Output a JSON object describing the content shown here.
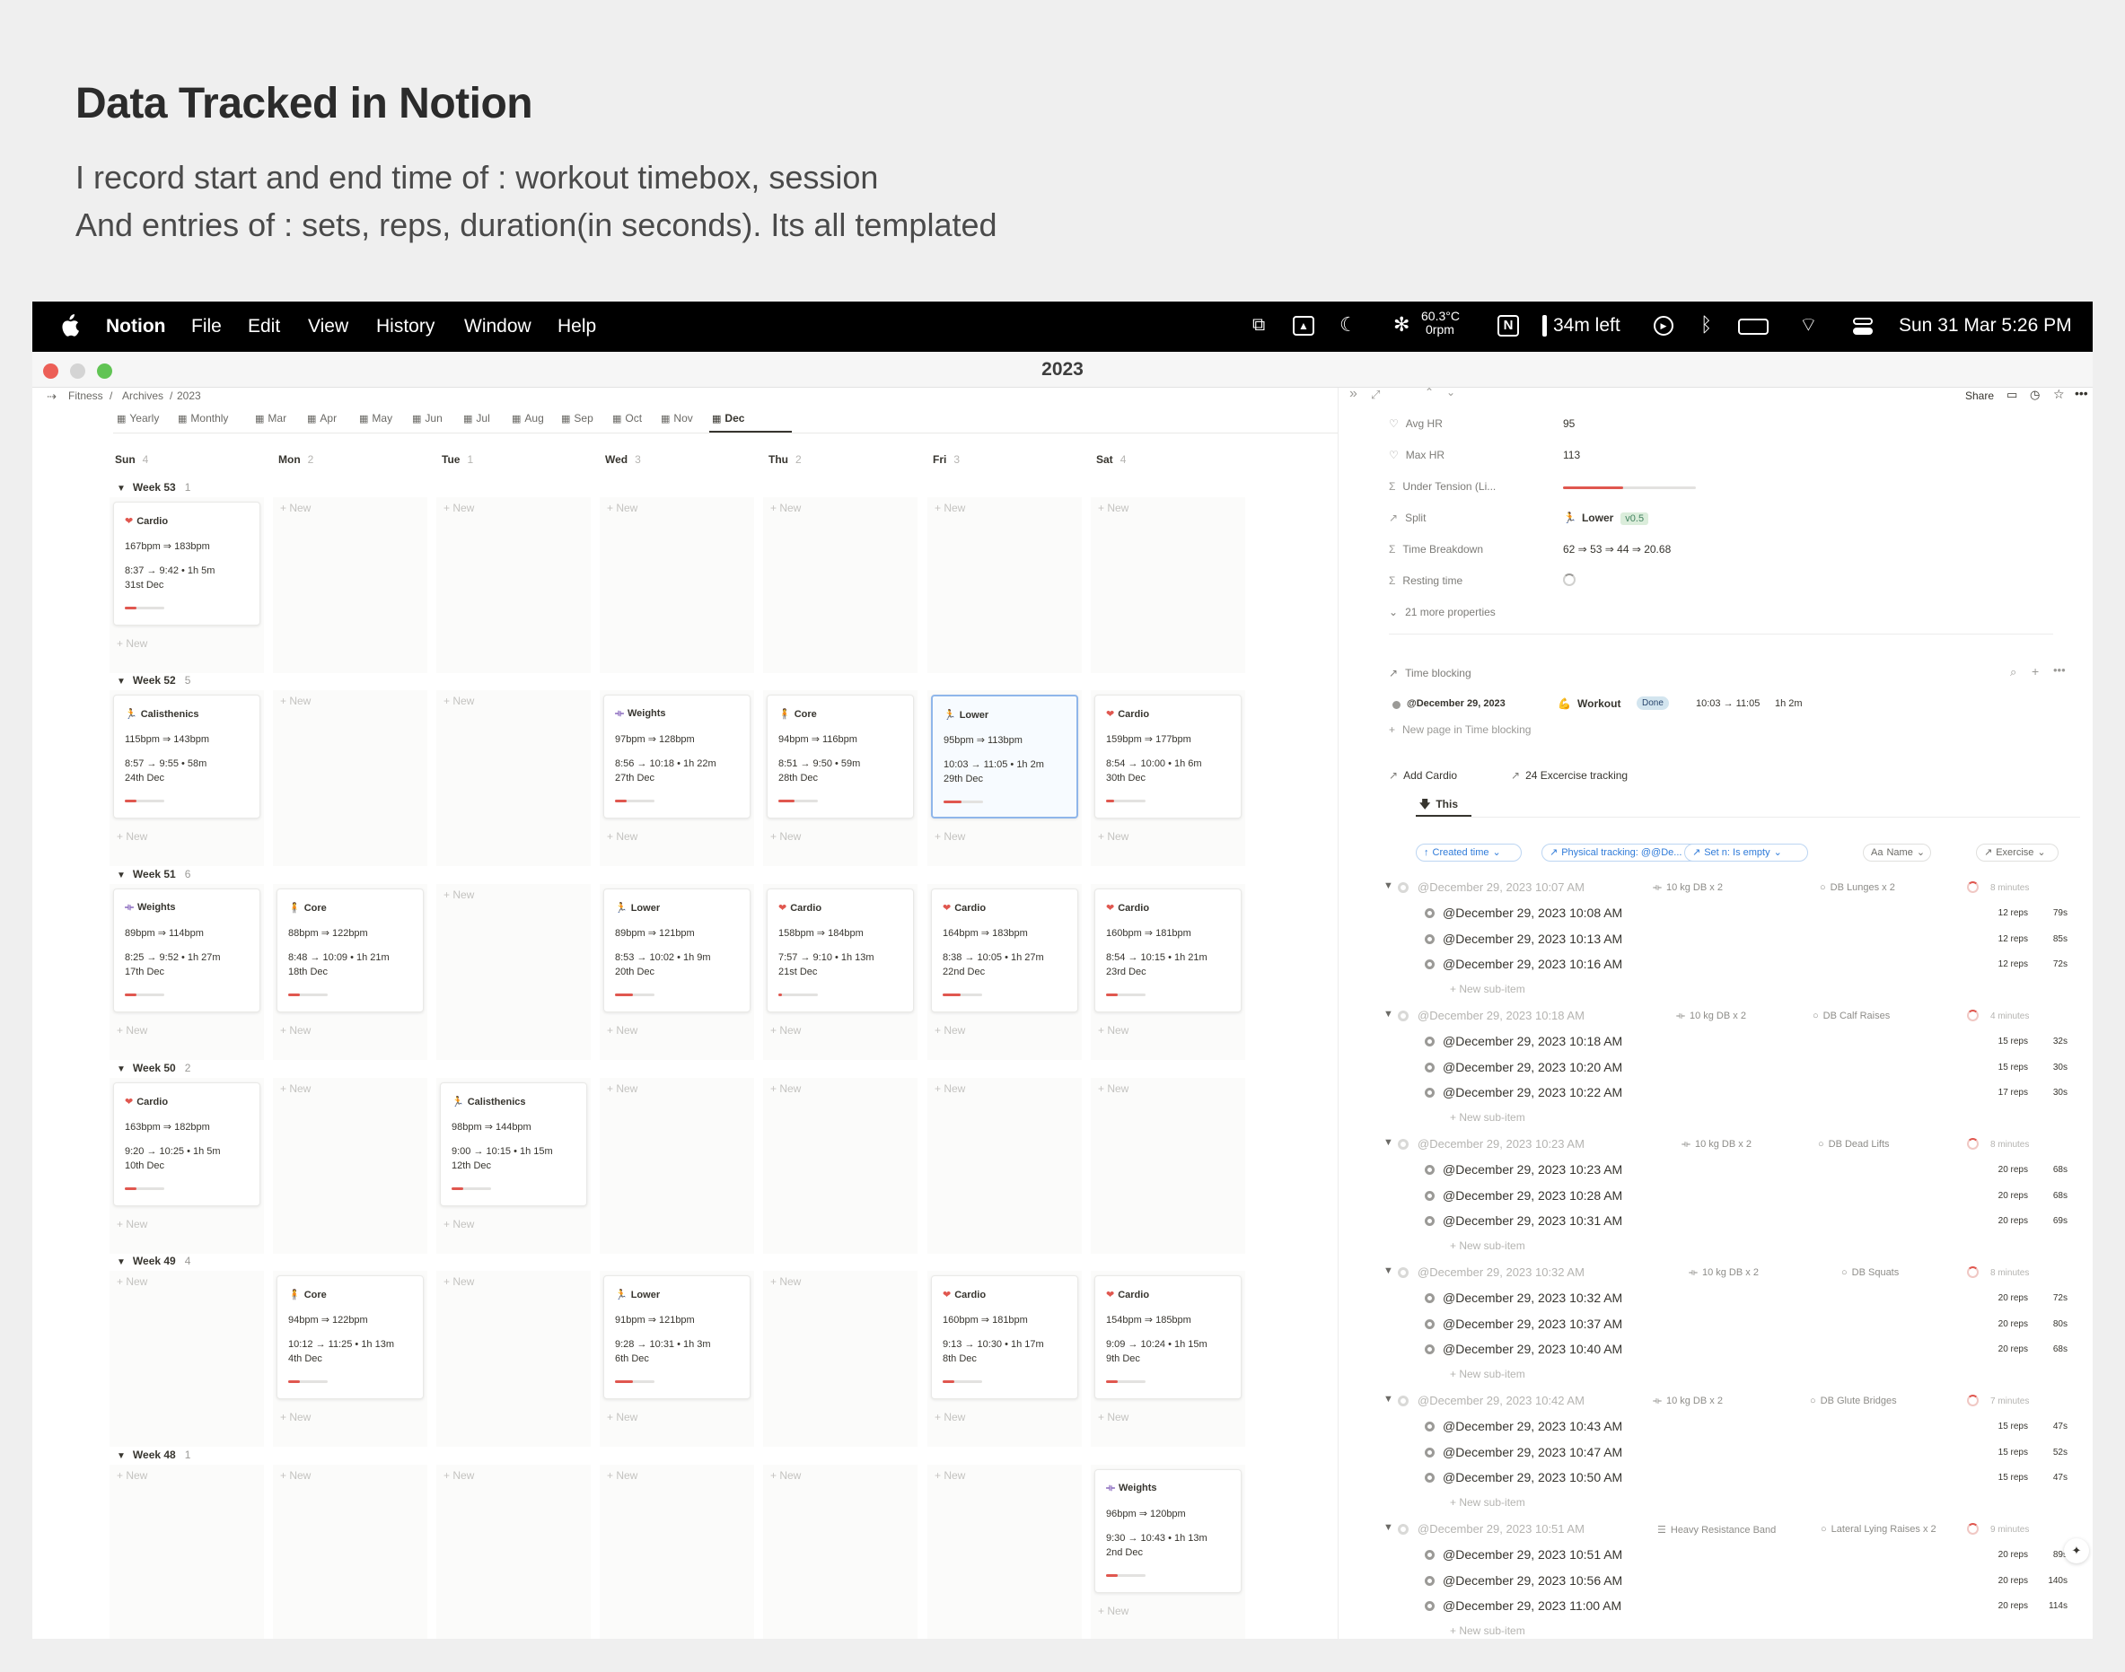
{
  "slide": {
    "title": "Data Tracked in Notion",
    "line1": "I record start and end time of : workout timebox, session",
    "line2": "And entries of : sets, reps, duration(in seconds). Its all templated"
  },
  "menubar": {
    "app": "Notion",
    "menus": [
      "File",
      "Edit",
      "View",
      "History",
      "Window",
      "Help"
    ],
    "temp": "60.3°C",
    "rpm": "0rpm",
    "battery": "34m left",
    "datetime": "Sun 31 Mar  5:26 PM"
  },
  "window": {
    "title": "2023"
  },
  "breadcrumb": [
    "Fitness",
    "Archives",
    "2023"
  ],
  "view_tabs": [
    "Yearly",
    "Monthly",
    "Mar",
    "Apr",
    "May",
    "Jun",
    "Jul",
    "Aug",
    "Sep",
    "Oct",
    "Nov",
    "Dec"
  ],
  "days": [
    {
      "name": "Sun",
      "count": "4"
    },
    {
      "name": "Mon",
      "count": "2"
    },
    {
      "name": "Tue",
      "count": "1"
    },
    {
      "name": "Wed",
      "count": "3"
    },
    {
      "name": "Thu",
      "count": "2"
    },
    {
      "name": "Fri",
      "count": "3"
    },
    {
      "name": "Sat",
      "count": "4"
    }
  ],
  "new_label": "New",
  "weeks": [
    {
      "label": "Week 53",
      "count": "1",
      "cards": [
        {
          "day": 0,
          "icon": "heart-icon",
          "type": "Cardio",
          "bpm": "167bpm ⇒ 183bpm",
          "time": "8:37 → 9:42 • 1h 5m",
          "date": "31st Dec",
          "progress": 0.3
        }
      ]
    },
    {
      "label": "Week 52",
      "count": "5",
      "cards": [
        {
          "day": 0,
          "icon": "calisthenics-icon",
          "type": "Calisthenics",
          "bpm": "115bpm ⇒ 143bpm",
          "time": "8:57 → 9:55 • 58m",
          "date": "24th Dec",
          "progress": 0.3
        },
        {
          "day": 3,
          "icon": "dumbbell-icon",
          "type": "Weights",
          "bpm": "97bpm ⇒ 128bpm",
          "time": "8:56 → 10:18 • 1h 22m",
          "date": "27th Dec",
          "progress": 0.3
        },
        {
          "day": 4,
          "icon": "core-icon",
          "type": "Core",
          "bpm": "94bpm ⇒ 116bpm",
          "time": "8:51 → 9:50 • 59m",
          "date": "28th Dec",
          "progress": 0.4
        },
        {
          "day": 5,
          "icon": "runner-icon",
          "type": "Lower",
          "bpm": "95bpm ⇒ 113bpm",
          "time": "10:03 → 11:05 • 1h 2m",
          "date": "29th Dec",
          "progress": 0.45,
          "selected": true
        },
        {
          "day": 6,
          "icon": "heart-icon",
          "type": "Cardio",
          "bpm": "159bpm ⇒ 177bpm",
          "time": "8:54 → 10:00 • 1h 6m",
          "date": "30th Dec",
          "progress": 0.2
        }
      ]
    },
    {
      "label": "Week 51",
      "count": "6",
      "cards": [
        {
          "day": 0,
          "icon": "dumbbell-icon",
          "type": "Weights",
          "bpm": "89bpm ⇒ 114bpm",
          "time": "8:25 → 9:52 • 1h 27m",
          "date": "17th Dec",
          "progress": 0.3
        },
        {
          "day": 1,
          "icon": "core-icon",
          "type": "Core",
          "bpm": "88bpm ⇒ 122bpm",
          "time": "8:48 → 10:09 • 1h 21m",
          "date": "18th Dec",
          "progress": 0.3
        },
        {
          "day": 3,
          "icon": "runner-icon",
          "type": "Lower",
          "bpm": "89bpm ⇒ 121bpm",
          "time": "8:53 → 10:02 • 1h 9m",
          "date": "20th Dec",
          "progress": 0.45
        },
        {
          "day": 4,
          "icon": "heart-icon",
          "type": "Cardio",
          "bpm": "158bpm ⇒ 184bpm",
          "time": "7:57 → 9:10 • 1h 13m",
          "date": "21st Dec",
          "progress": 0.1
        },
        {
          "day": 5,
          "icon": "heart-icon",
          "type": "Cardio",
          "bpm": "164bpm ⇒ 183bpm",
          "time": "8:38 → 10:05 • 1h 27m",
          "date": "22nd Dec",
          "progress": 0.45
        },
        {
          "day": 6,
          "icon": "heart-icon",
          "type": "Cardio",
          "bpm": "160bpm ⇒ 181bpm",
          "time": "8:54 → 10:15 • 1h 21m",
          "date": "23rd Dec",
          "progress": 0.3
        }
      ]
    },
    {
      "label": "Week 50",
      "count": "2",
      "cards": [
        {
          "day": 0,
          "icon": "heart-icon",
          "type": "Cardio",
          "bpm": "163bpm ⇒ 182bpm",
          "time": "9:20 → 10:25 • 1h 5m",
          "date": "10th Dec",
          "progress": 0.3
        },
        {
          "day": 2,
          "icon": "calisthenics-icon",
          "type": "Calisthenics",
          "bpm": "98bpm ⇒ 144bpm",
          "time": "9:00 → 10:15 • 1h 15m",
          "date": "12th Dec",
          "progress": 0.3
        }
      ]
    },
    {
      "label": "Week 49",
      "count": "4",
      "cards": [
        {
          "day": 1,
          "icon": "core-icon",
          "type": "Core",
          "bpm": "94bpm ⇒ 122bpm",
          "time": "10:12 → 11:25 • 1h 13m",
          "date": "4th Dec",
          "progress": 0.3
        },
        {
          "day": 3,
          "icon": "runner-icon",
          "type": "Lower",
          "bpm": "91bpm ⇒ 121bpm",
          "time": "9:28 → 10:31 • 1h 3m",
          "date": "6th Dec",
          "progress": 0.45
        },
        {
          "day": 5,
          "icon": "heart-icon",
          "type": "Cardio",
          "bpm": "160bpm ⇒ 181bpm",
          "time": "9:13 → 10:30 • 1h 17m",
          "date": "8th Dec",
          "progress": 0.3
        },
        {
          "day": 6,
          "icon": "heart-icon",
          "type": "Cardio",
          "bpm": "154bpm ⇒ 185bpm",
          "time": "9:09 → 10:24 • 1h 15m",
          "date": "9th Dec",
          "progress": 0.3
        }
      ]
    },
    {
      "label": "Week 48",
      "count": "1",
      "cards": [
        {
          "day": 6,
          "icon": "dumbbell-icon",
          "type": "Weights",
          "bpm": "96bpm ⇒ 120bpm",
          "time": "9:30 → 10:43 • 1h 13m",
          "date": "2nd Dec",
          "progress": 0.3
        }
      ]
    }
  ],
  "detail": {
    "topbar": {
      "share": "Share"
    },
    "props": [
      {
        "icon": "heart-icon",
        "label": "Avg HR",
        "value": "95"
      },
      {
        "icon": "heart-icon",
        "label": "Max HR",
        "value": "113"
      },
      {
        "icon": "sigma-icon",
        "label": "Under Tension (Li...",
        "value": ""
      },
      {
        "icon": "arrow-icon",
        "label": "Split",
        "value": "Lower",
        "tag": "v0.5"
      },
      {
        "icon": "sigma-icon",
        "label": "Time Breakdown",
        "value": "62 ⇒ 53 ⇒ 44 ⇒ 20.68"
      },
      {
        "icon": "sigma-icon",
        "label": "Resting time",
        "value": ""
      }
    ],
    "under_tension_fill": 0.45,
    "more_props": "21 more properties",
    "time_blocking": {
      "label": "Time blocking",
      "date": "@December 29, 2023",
      "name": "Workout",
      "status": "Done",
      "time": "10:03 → 11:05",
      "dur": "1h 2m",
      "new_page": "New page in Time blocking"
    },
    "links": {
      "add_cardio": "Add Cardio",
      "tracking": "24 Excercise tracking"
    },
    "this_label": "This",
    "filters": [
      "Created time",
      "Physical tracking: @@De...",
      "Set n: Is empty",
      "Name",
      "Exercise"
    ],
    "groups": [
      {
        "header": "@December 29, 2023 10:07 AM",
        "equip": "10 kg DB x 2",
        "exercise": "DB Lunges x 2",
        "minutes": "8 minutes",
        "items": [
          {
            "t": "@December 29, 2023 10:08 AM",
            "reps": "12 reps",
            "secs": "79s"
          },
          {
            "t": "@December 29, 2023 10:13 AM",
            "reps": "12 reps",
            "secs": "85s"
          },
          {
            "t": "@December 29, 2023 10:16 AM",
            "reps": "12 reps",
            "secs": "72s"
          }
        ]
      },
      {
        "header": "@December 29, 2023 10:18 AM",
        "equip": "10 kg DB x 2",
        "exercise": "DB Calf Raises",
        "minutes": "4 minutes",
        "items": [
          {
            "t": "@December 29, 2023 10:18 AM",
            "reps": "15 reps",
            "secs": "32s"
          },
          {
            "t": "@December 29, 2023 10:20 AM",
            "reps": "15 reps",
            "secs": "30s"
          },
          {
            "t": "@December 29, 2023 10:22 AM",
            "reps": "17 reps",
            "secs": "30s"
          }
        ]
      },
      {
        "header": "@December 29, 2023 10:23 AM",
        "equip": "10 kg DB x 2",
        "exercise": "DB Dead Lifts",
        "minutes": "8 minutes",
        "items": [
          {
            "t": "@December 29, 2023 10:23 AM",
            "reps": "20 reps",
            "secs": "68s"
          },
          {
            "t": "@December 29, 2023 10:28 AM",
            "reps": "20 reps",
            "secs": "68s"
          },
          {
            "t": "@December 29, 2023 10:31 AM",
            "reps": "20 reps",
            "secs": "69s"
          }
        ]
      },
      {
        "header": "@December 29, 2023 10:32 AM",
        "equip": "10 kg DB x 2",
        "exercise": "DB Squats",
        "minutes": "8 minutes",
        "items": [
          {
            "t": "@December 29, 2023 10:32 AM",
            "reps": "20 reps",
            "secs": "72s"
          },
          {
            "t": "@December 29, 2023 10:37 AM",
            "reps": "20 reps",
            "secs": "80s"
          },
          {
            "t": "@December 29, 2023 10:40 AM",
            "reps": "20 reps",
            "secs": "68s"
          }
        ]
      },
      {
        "header": "@December 29, 2023 10:42 AM",
        "equip": "10 kg DB x 2",
        "exercise": "DB Glute Bridges",
        "minutes": "7 minutes",
        "items": [
          {
            "t": "@December 29, 2023 10:43 AM",
            "reps": "15 reps",
            "secs": "47s"
          },
          {
            "t": "@December 29, 2023 10:47 AM",
            "reps": "15 reps",
            "secs": "52s"
          },
          {
            "t": "@December 29, 2023 10:50 AM",
            "reps": "15 reps",
            "secs": "47s"
          }
        ]
      },
      {
        "header": "@December 29, 2023 10:51 AM",
        "equip": "Heavy Resistance Band",
        "exercise": "Lateral Lying Raises x 2",
        "minutes": "9 minutes",
        "items": [
          {
            "t": "@December 29, 2023 10:51 AM",
            "reps": "20 reps",
            "secs": "89s"
          },
          {
            "t": "@December 29, 2023 10:56 AM",
            "reps": "20 reps",
            "secs": "140s"
          },
          {
            "t": "@December 29, 2023 11:00 AM",
            "reps": "20 reps",
            "secs": "114s"
          }
        ]
      }
    ],
    "new_sub_item": "New sub-item"
  },
  "colors": {
    "accent": "#2f7bd9",
    "progress": "#e0574f",
    "selected_border": "#8fb6ea"
  }
}
